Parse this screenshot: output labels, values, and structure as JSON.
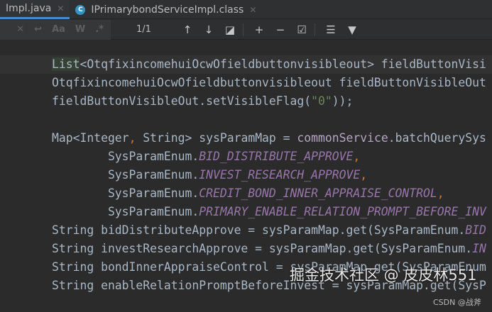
{
  "tabs": [
    {
      "label": "Impl.java",
      "active": true
    },
    {
      "label": "IPrimarybondServiceImpl.class",
      "active": false
    }
  ],
  "find": {
    "count": "1/1",
    "match_case": "Aa",
    "words": "W",
    "regex": ".*"
  },
  "code": [
    [
      [
        "hl",
        "List"
      ],
      [
        "",
        "<OtqfixincomehuiOcwOfieldbuttonvisibleout> fieldButtonVisi"
      ]
    ],
    [
      [
        "",
        "OtqfixincomehuiOcwOfieldbuttonvisibleout fieldButtonVisibleOut"
      ]
    ],
    [
      [
        "",
        "fieldButtonVisibleOut.setVisibleFlag("
      ],
      [
        "s",
        "\"0\""
      ],
      [
        "",
        "));"
      ]
    ],
    [
      [
        "",
        ""
      ]
    ],
    [
      [
        "",
        "Map<Integer"
      ],
      [
        "f",
        ","
      ],
      [
        "",
        " String> sysParamMap = "
      ],
      [
        "m",
        "commonService"
      ],
      [
        "",
        ".batchQuerySys"
      ]
    ],
    [
      [
        "",
        "        SysParamEnum."
      ],
      [
        "i",
        "BID_DISTRIBUTE_APPROVE"
      ],
      [
        "f",
        ","
      ]
    ],
    [
      [
        "",
        "        SysParamEnum."
      ],
      [
        "i",
        "INVEST_RESEARCH_APPROVE"
      ],
      [
        "f",
        ","
      ]
    ],
    [
      [
        "",
        "        SysParamEnum."
      ],
      [
        "i",
        "CREDIT_BOND_INNER_APPRAISE_CONTROL"
      ],
      [
        "f",
        ","
      ]
    ],
    [
      [
        "",
        "        SysParamEnum."
      ],
      [
        "i",
        "PRIMARY_ENABLE_RELATION_PROMPT_BEFORE_INV"
      ]
    ],
    [
      [
        "",
        "String bidDistributeApprove = sysParamMap.get(SysParamEnum."
      ],
      [
        "i",
        "BID"
      ]
    ],
    [
      [
        "",
        "String investResearchApprove = sysParamMap.get(SysParamEnum."
      ],
      [
        "i",
        "IN"
      ]
    ],
    [
      [
        "",
        "String bondInnerAppraiseControl = sysParamMap.get(SysParamEnum"
      ]
    ],
    [
      [
        "",
        "String enableRelationPromptBeforeInvest = sysParamMap.get(SysP"
      ]
    ]
  ],
  "watermark": "掘金技术社区 @ 皮皮林551",
  "watermark2": "CSDN @战斧"
}
